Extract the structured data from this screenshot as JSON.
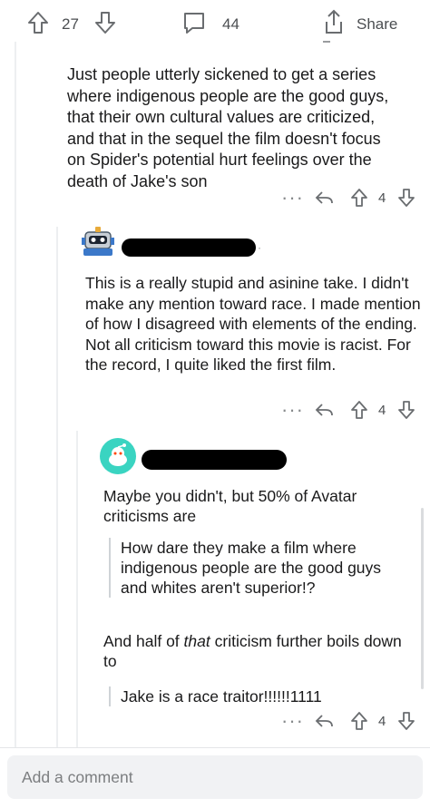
{
  "top_bar": {
    "upvote_count": "27",
    "comment_count": "44",
    "share_label": "Share"
  },
  "comment1": {
    "body": "Just people utterly sickened to get a series where indigenous people are the good guys, that their own cultural values are criticized, and that in the sequel the film doesn't focus on Spider's potential hurt feelings over the death of Jake's son",
    "vote_count": "4"
  },
  "comment2": {
    "body": "This is a really stupid and asinine take. I didn't make any mention toward race. I made mention of how I disagreed with elements of the ending. Not all criticism toward this movie is racist. For the record, I quite liked the first film.",
    "vote_count": "4"
  },
  "comment3": {
    "intro": "Maybe you didn't, but 50% of Avatar criticisms are",
    "quote1": "How dare they make a film where indigenous people are the good guys and whites aren't superior!?",
    "para2_pre": "And half of ",
    "para2_em": "that",
    "para2_post": " criticism further boils down to",
    "quote2": "Jake is a race traitor!!!!!!1111",
    "vote_count": "4"
  },
  "composer": {
    "placeholder": "Add a comment"
  },
  "colors": {
    "text": "#1a1a1b",
    "muted": "#878a8c",
    "thread_line": "#edeff1",
    "avatar_teal": "#3ad4c1"
  }
}
